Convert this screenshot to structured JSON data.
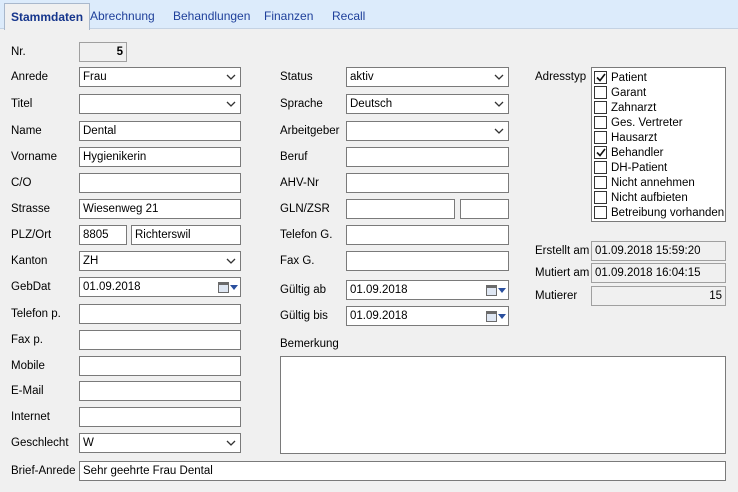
{
  "tabs": [
    "Stammdaten",
    "Abrechnung",
    "Behandlungen",
    "Finanzen",
    "Recall"
  ],
  "left": {
    "nr": {
      "label": "Nr.",
      "value": "5"
    },
    "anrede": {
      "label": "Anrede",
      "value": "Frau"
    },
    "titel": {
      "label": "Titel",
      "value": ""
    },
    "name": {
      "label": "Name",
      "value": "Dental"
    },
    "vorname": {
      "label": "Vorname",
      "value": "Hygienikerin"
    },
    "co": {
      "label": "C/O",
      "value": ""
    },
    "strasse": {
      "label": "Strasse",
      "value": "Wiesenweg 21"
    },
    "plzort": {
      "label": "PLZ/Ort",
      "plz": "8805",
      "ort": "Richterswil"
    },
    "kanton": {
      "label": "Kanton",
      "value": "ZH"
    },
    "gebdat": {
      "label": "GebDat",
      "value": "01.09.2018"
    },
    "telefon": {
      "label": "Telefon p.",
      "value": ""
    },
    "fax": {
      "label": "Fax p.",
      "value": ""
    },
    "mobile": {
      "label": "Mobile",
      "value": ""
    },
    "email": {
      "label": "E-Mail",
      "value": ""
    },
    "internet": {
      "label": "Internet",
      "value": ""
    },
    "geschlecht": {
      "label": "Geschlecht",
      "value": "W"
    },
    "briefanrede": {
      "label": "Brief-Anrede",
      "value": "Sehr geehrte Frau Dental"
    }
  },
  "middle": {
    "status": {
      "label": "Status",
      "value": "aktiv"
    },
    "sprache": {
      "label": "Sprache",
      "value": "Deutsch"
    },
    "arbeitgeber": {
      "label": "Arbeitgeber",
      "value": ""
    },
    "beruf": {
      "label": "Beruf",
      "value": ""
    },
    "ahv": {
      "label": "AHV-Nr",
      "value": ""
    },
    "gln": {
      "label": "GLN/ZSR",
      "value1": "",
      "value2": ""
    },
    "telefon_g": {
      "label": "Telefon G.",
      "value": ""
    },
    "fax_g": {
      "label": "Fax G.",
      "value": ""
    },
    "gueltig_ab": {
      "label": "Gültig ab",
      "value": "01.09.2018"
    },
    "gueltig_bis": {
      "label": "Gültig bis",
      "value": "01.09.2018"
    },
    "bemerkung": {
      "label": "Bemerkung",
      "value": ""
    }
  },
  "right": {
    "adresstyp_label": "Adresstyp",
    "adresstyp": [
      {
        "label": "Patient",
        "checked": true
      },
      {
        "label": "Garant",
        "checked": false
      },
      {
        "label": "Zahnarzt",
        "checked": false
      },
      {
        "label": "Ges. Vertreter",
        "checked": false
      },
      {
        "label": "Hausarzt",
        "checked": false
      },
      {
        "label": "Behandler",
        "checked": true
      },
      {
        "label": "DH-Patient",
        "checked": false
      },
      {
        "label": "Nicht annehmen",
        "checked": false
      },
      {
        "label": "Nicht aufbieten",
        "checked": false
      },
      {
        "label": "Betreibung vorhanden",
        "checked": false
      }
    ],
    "erstellt": {
      "label": "Erstellt am",
      "value": "01.09.2018 15:59:20"
    },
    "mutiert": {
      "label": "Mutiert am",
      "value": "01.09.2018 16:04:15"
    },
    "mutierer": {
      "label": "Mutierer",
      "value": "15"
    }
  }
}
